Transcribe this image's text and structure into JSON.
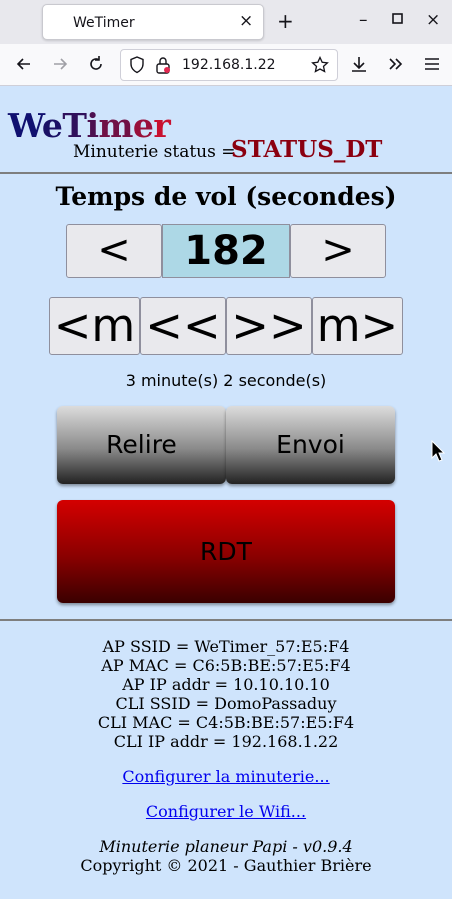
{
  "browser": {
    "tab_title": "WeTimer",
    "tab_close": "×",
    "new_tab": "+",
    "url": "192.168.1.22",
    "window_controls": {
      "minimize": "–",
      "maximize": "□",
      "close": "×"
    },
    "icons": [
      "back-arrow-icon",
      "forward-arrow-icon",
      "reload-icon",
      "shield-icon",
      "insecure-lock-icon",
      "bookmark-star-icon",
      "download-icon",
      "more-tools-icon",
      "menu-icon"
    ]
  },
  "header": {
    "logo": "WeTimer",
    "status_label": "Minuterie status = ",
    "status_value": "STATUS_DT"
  },
  "timer": {
    "heading": "Temps de vol (secondes)",
    "dec_label": "<",
    "value": "182",
    "inc_label": ">",
    "min_dec_label": "<m",
    "fast_dec_label": "<<",
    "fast_inc_label": ">>",
    "min_inc_label": "m>",
    "duration_text": "3 minute(s) 2 seconde(s)"
  },
  "actions": {
    "reload_label": "Relire",
    "send_label": "Envoi",
    "rdt_label": "RDT"
  },
  "info": [
    "AP SSID = WeTimer_57:E5:F4",
    "AP MAC = C6:5B:BE:57:E5:F4",
    "AP IP addr = 10.10.10.10",
    "CLI SSID = DomoPassaduy",
    "CLI MAC = C4:5B:BE:57:E5:F4",
    "CLI IP addr = 192.168.1.22"
  ],
  "links": {
    "configure_timer": "Configurer la minuterie...",
    "configure_wifi": "Configurer le Wifi..."
  },
  "footer": {
    "version": "Minuterie planeur Papi - v0.9.4",
    "copyright": "Copyright © 2021 - Gauthier Brière"
  },
  "colors": {
    "page_bg": "#cfe4fc",
    "status_red": "#8b0010",
    "value_bg": "#add8e6",
    "rdt_red": "#d40000",
    "link_blue": "#0000ee"
  }
}
